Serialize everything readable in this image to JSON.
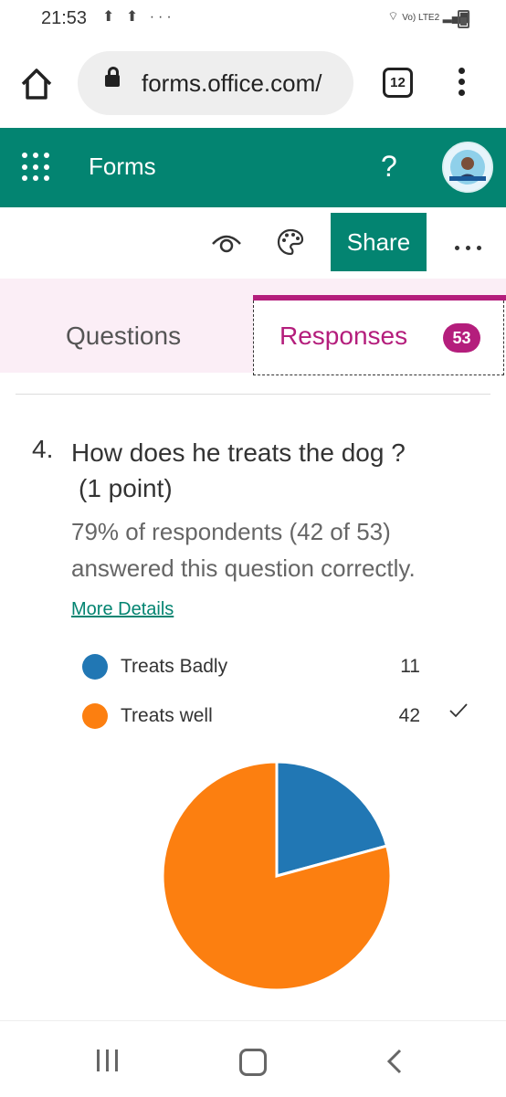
{
  "status_bar": {
    "time": "21:53",
    "extra_icons": "⬆ ⬆ ···",
    "network": "Vo) LTE2"
  },
  "browser": {
    "url": "forms.office.com/",
    "tab_count": "12"
  },
  "header": {
    "app_name": "Forms",
    "help": "?"
  },
  "toolbar": {
    "share_label": "Share"
  },
  "tabs": {
    "questions_label": "Questions",
    "responses_label": "Responses",
    "responses_count": "53"
  },
  "question": {
    "number": "4.",
    "text": "How does he treats the dog ?",
    "points": "(1 point)",
    "result_line1": "79% of respondents (42 of 53)",
    "result_line2": "answered this question correctly.",
    "more_details": "More Details"
  },
  "chart_data": {
    "type": "pie",
    "categories": [
      "Treats Badly",
      "Treats well"
    ],
    "values": [
      11,
      42
    ],
    "colors": [
      "#2177b4",
      "#fc7f10"
    ],
    "correct": "Treats well"
  }
}
